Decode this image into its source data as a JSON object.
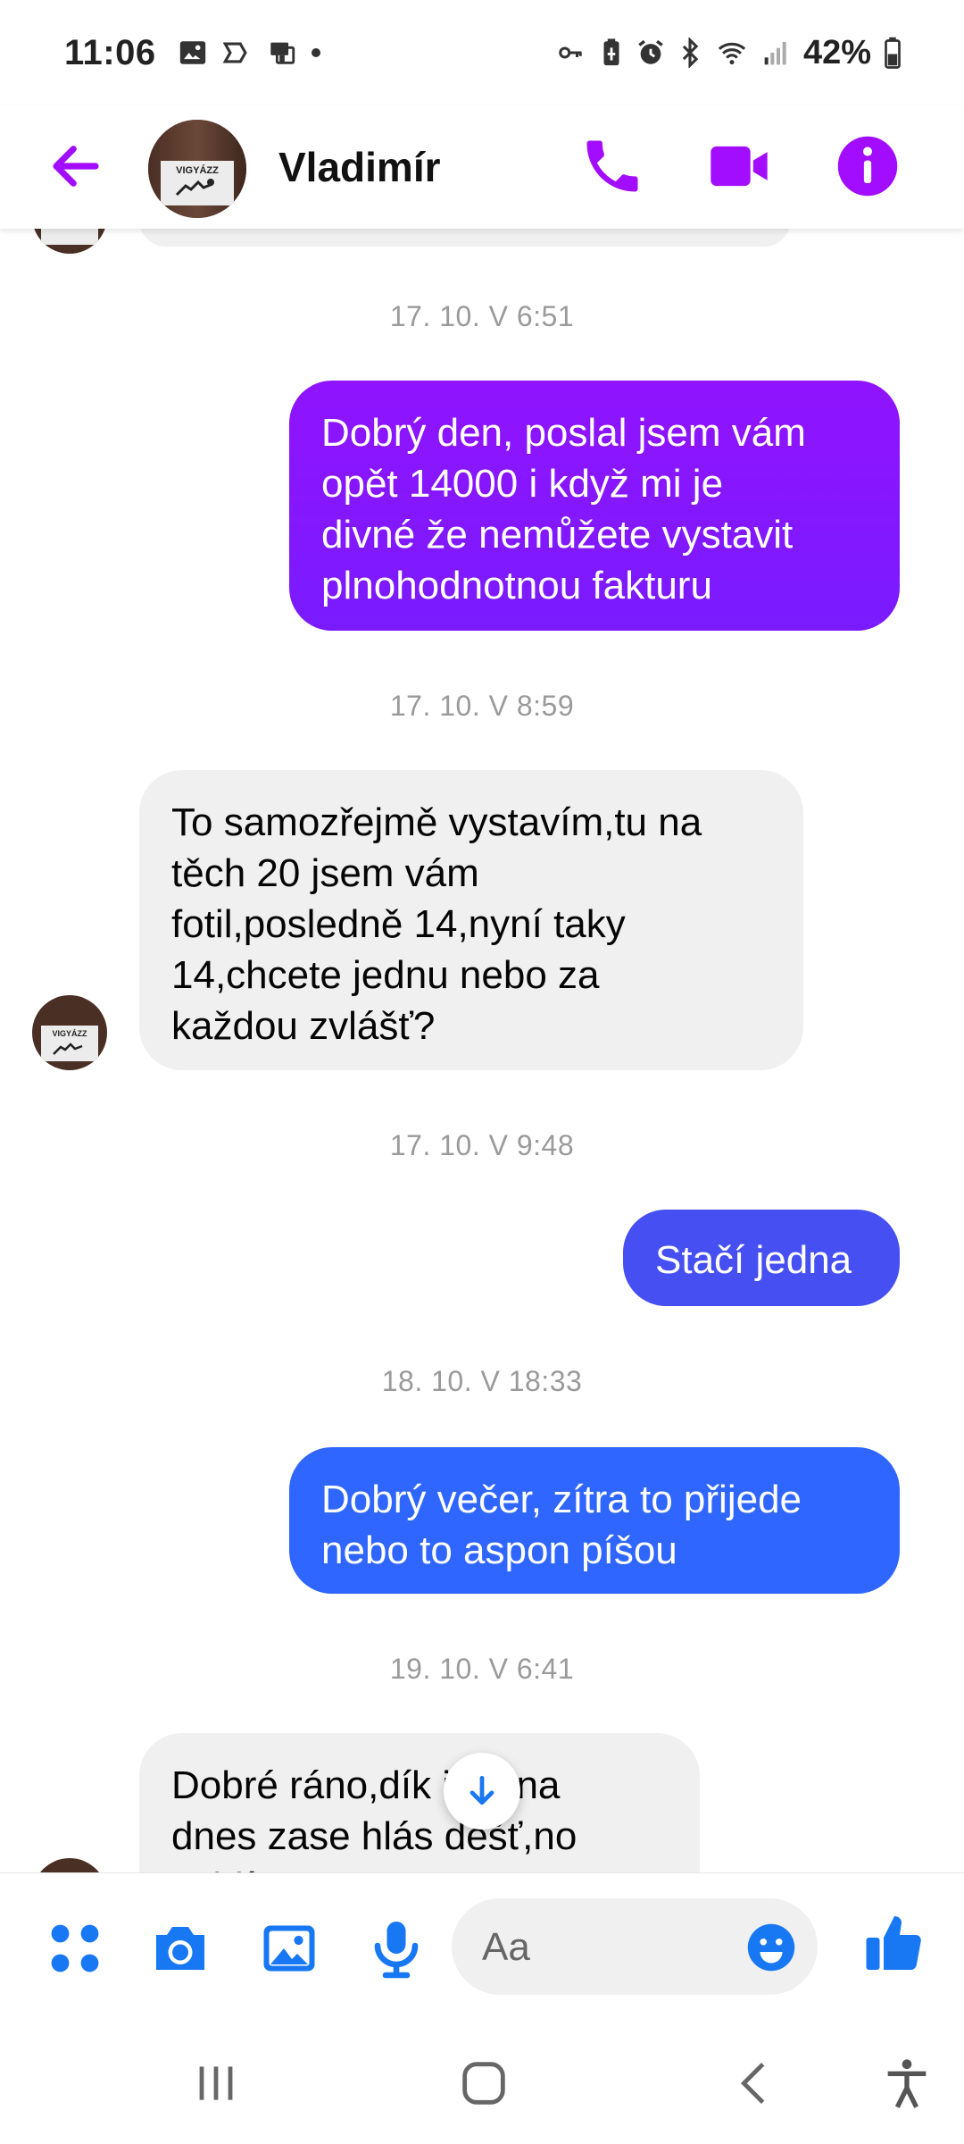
{
  "status_bar": {
    "time": "11:06",
    "battery": "42%",
    "left_icons": [
      "gallery-icon",
      "tv-icon",
      "nfc-icon"
    ],
    "right_icons": [
      "key-icon",
      "battery-saver-icon",
      "alarm-icon",
      "bluetooth-icon",
      "wifi-icon",
      "signal-icon",
      "battery-icon"
    ]
  },
  "header": {
    "contact_name": "Vladimír",
    "avatar_text": "VIGYÁZZ",
    "accent_color": "#a20cff",
    "icons": [
      "back-arrow-icon",
      "phone-icon",
      "video-icon",
      "info-icon"
    ]
  },
  "messages": [
    {
      "type": "timestamp",
      "text": "17. 10. V 6:51"
    },
    {
      "type": "outgoing",
      "lines": [
        "Dobrý den,  poslal jsem vám",
        "opět 14000 i když mi je",
        "divné že nemůžete vystavit",
        "plnohodnotnou fakturu"
      ],
      "color": "#8f14ff"
    },
    {
      "type": "timestamp",
      "text": "17. 10. V 8:59"
    },
    {
      "type": "incoming",
      "lines": [
        "To samozřejmě vystavím,tu na",
        "těch 20 jsem vám",
        "fotil,posledně 14,nyní taky",
        "14,chcete jednu nebo za",
        "každou zvlášť?"
      ]
    },
    {
      "type": "timestamp",
      "text": "17. 10. V 9:48"
    },
    {
      "type": "outgoing",
      "lines": [
        "Stačí jedna"
      ],
      "color": "#4650f2"
    },
    {
      "type": "timestamp",
      "text": "18. 10. V 18:33"
    },
    {
      "type": "outgoing",
      "lines": [
        "Dobrý večer,  zítra to přijede",
        "nebo to aspon píšou"
      ],
      "color": "#2f66ff"
    },
    {
      "type": "timestamp",
      "text": "19. 10. V 6:41"
    },
    {
      "type": "incoming",
      "lines": [
        "Dobré ráno,dík     info,na",
        "dnes zase hlás    děšť,no",
        "uvidí"
      ]
    }
  ],
  "composer": {
    "placeholder": "Aa",
    "accent_color": "#1877f2",
    "icons": [
      "apps-icon",
      "camera-icon",
      "image-icon",
      "microphone-icon",
      "emoji-icon",
      "thumbs-up-icon"
    ]
  },
  "navigation": {
    "icons": [
      "recent-apps-icon",
      "home-icon",
      "back-icon",
      "accessibility-icon"
    ]
  }
}
